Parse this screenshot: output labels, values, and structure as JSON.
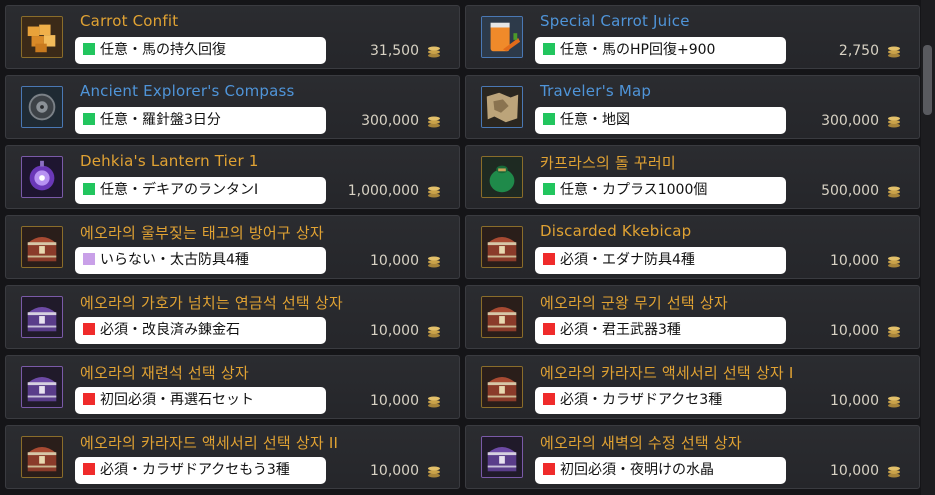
{
  "colors": {
    "green": "#22c55e",
    "red": "#ef2b2b",
    "purple": "#c9a0e8",
    "gold": "#e0a233",
    "blue": "#4f94d8"
  },
  "items": [
    {
      "name": "Carrot Confit",
      "name_color": "gold",
      "icon": "carrot-confit-icon",
      "tag_color": "green",
      "tag": "任意・馬の持久回復",
      "price": "31,500"
    },
    {
      "name": "Special Carrot Juice",
      "name_color": "blue",
      "icon": "carrot-juice-icon",
      "tag_color": "green",
      "tag": "任意・馬のHP回復+900",
      "price": "2,750"
    },
    {
      "name": "Ancient Explorer's Compass",
      "name_color": "blue",
      "icon": "compass-icon",
      "tag_color": "green",
      "tag": "任意・羅針盤3日分",
      "price": "300,000"
    },
    {
      "name": "Traveler's Map",
      "name_color": "blue",
      "icon": "map-icon",
      "tag_color": "green",
      "tag": "任意・地図",
      "price": "300,000"
    },
    {
      "name": "Dehkia's Lantern Tier 1",
      "name_color": "gold",
      "icon": "lantern-icon",
      "tag_color": "green",
      "tag": "任意・デキアのランタンI",
      "price": "1,000,000"
    },
    {
      "name": "카프라스의 돌 꾸러미",
      "name_color": "gold",
      "icon": "stone-pouch-icon",
      "tag_color": "green",
      "tag": "任意・カプラス1000個",
      "price": "500,000"
    },
    {
      "name": "에오라의 울부짖는 태고의 방어구 상자",
      "name_color": "gold",
      "icon": "treasure-chest-icon",
      "tag_color": "purple",
      "tag": "いらない・太古防具4種",
      "price": "10,000"
    },
    {
      "name": "Discarded Kkebicap",
      "name_color": "gold",
      "icon": "treasure-chest-icon",
      "tag_color": "red",
      "tag": "必須・エダナ防具4種",
      "price": "10,000"
    },
    {
      "name": "에오라의 가호가 넘치는 연금석 선택 상자",
      "name_color": "gold",
      "icon": "treasure-chest-purple-icon",
      "tag_color": "red",
      "tag": "必須・改良済み錬金石",
      "price": "10,000"
    },
    {
      "name": "에오라의 군왕 무기 선택 상자",
      "name_color": "gold",
      "icon": "treasure-chest-icon",
      "tag_color": "red",
      "tag": "必須・君王武器3種",
      "price": "10,000"
    },
    {
      "name": "에오라의 재련석 선택 상자",
      "name_color": "gold",
      "icon": "treasure-chest-purple-icon",
      "tag_color": "red",
      "tag": "初回必須・再選石セット",
      "price": "10,000"
    },
    {
      "name": "에오라의 카라자드 액세서리 선택 상자 I",
      "name_color": "gold",
      "icon": "treasure-chest-icon",
      "tag_color": "red",
      "tag": "必須・カラザドアクセ3種",
      "price": "10,000"
    },
    {
      "name": "에오라의 카라자드 액세서리 선택 상자 II",
      "name_color": "gold",
      "icon": "treasure-chest-icon",
      "tag_color": "red",
      "tag": "必須・カラザドアクセもう3種",
      "price": "10,000"
    },
    {
      "name": "에오라의 새벽의 수정 선택 상자",
      "name_color": "gold",
      "icon": "treasure-chest-purple-icon",
      "tag_color": "red",
      "tag": "初回必須・夜明けの水晶",
      "price": "10,000"
    }
  ]
}
